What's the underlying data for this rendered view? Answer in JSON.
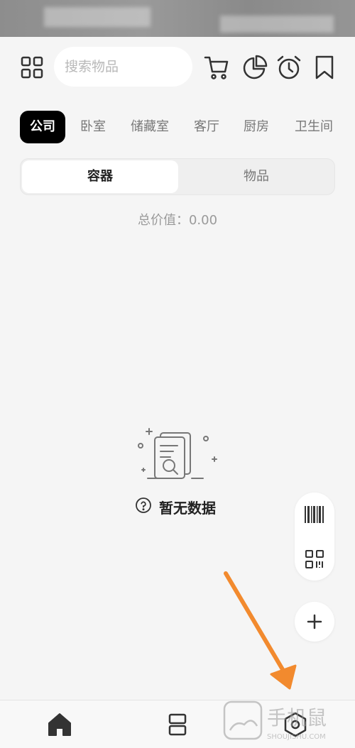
{
  "toolbar": {
    "search_placeholder": "搜索物品",
    "icons": [
      "grid-menu-icon",
      "cart-icon",
      "pie-chart-icon",
      "alarm-clock-icon",
      "bookmark-icon"
    ]
  },
  "categories": [
    {
      "label": "公司",
      "active": true
    },
    {
      "label": "卧室",
      "active": false
    },
    {
      "label": "储藏室",
      "active": false
    },
    {
      "label": "客厅",
      "active": false
    },
    {
      "label": "厨房",
      "active": false
    },
    {
      "label": "卫生间",
      "active": false
    }
  ],
  "segment": {
    "containers_label": "容器",
    "items_label": "物品",
    "active": "容器"
  },
  "summary": {
    "total_value": "总价值：0.00"
  },
  "empty_state": {
    "text": "暂无数据"
  },
  "floating": {
    "icons": [
      "barcode-icon",
      "qr-code-icon",
      "plus-icon"
    ]
  },
  "bottom_nav": {
    "icons": [
      "home-icon",
      "layers-icon",
      "settings-icon"
    ]
  },
  "watermark": {
    "text": "手机鼠",
    "subtext": "SHOUJISHU.COM"
  },
  "colors": {
    "background": "#f5f5f5",
    "active_tab": "#000000",
    "arrow": "#f28a2e"
  }
}
